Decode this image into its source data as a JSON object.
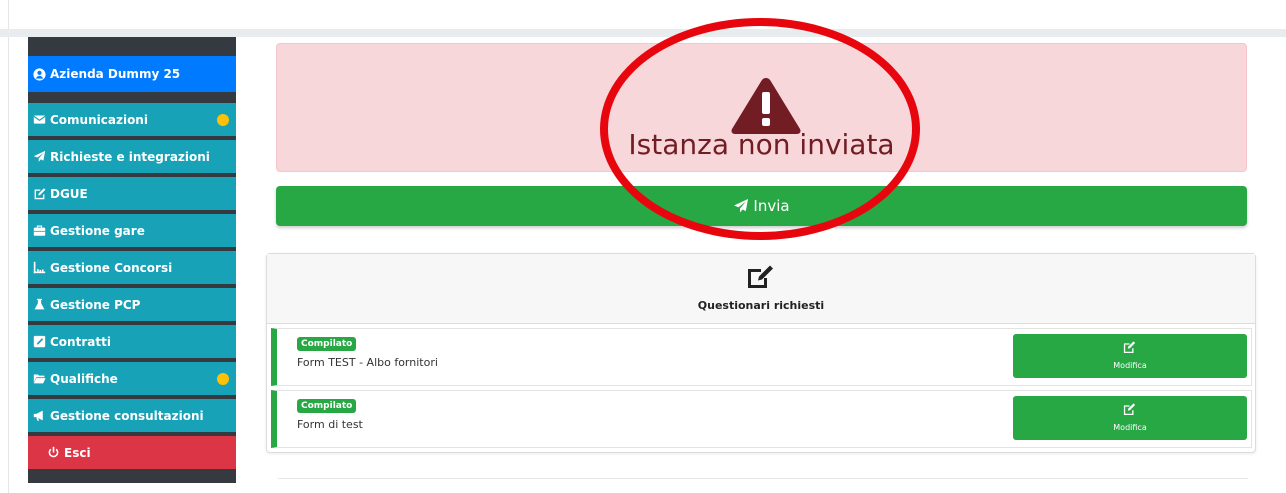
{
  "sidebar": {
    "user": "Azienda Dummy 25",
    "items": [
      {
        "label": "Comunicazioni",
        "icon": "envelope-icon",
        "badge": true
      },
      {
        "label": "Richieste e integrazioni",
        "icon": "paper-plane-icon",
        "badge": false
      },
      {
        "label": "DGUE",
        "icon": "edit-icon",
        "badge": false
      },
      {
        "label": "Gestione gare",
        "icon": "briefcase-icon",
        "badge": false
      },
      {
        "label": "Gestione Concorsi",
        "icon": "chart-icon",
        "badge": false
      },
      {
        "label": "Gestione PCP",
        "icon": "flask-icon",
        "badge": false
      },
      {
        "label": "Contratti",
        "icon": "pencil-square-icon",
        "badge": false
      },
      {
        "label": "Qualifiche",
        "icon": "folder-open-icon",
        "badge": true
      },
      {
        "label": "Gestione consultazioni",
        "icon": "bullhorn-icon",
        "badge": false
      }
    ],
    "exit_label": "Esci",
    "badge_color": "#ffc107"
  },
  "alert": {
    "text": "Istanza non inviata",
    "icon": "warning-triangle-icon"
  },
  "send_button": {
    "label": "Invia",
    "icon": "paper-plane-icon"
  },
  "questionnaires": {
    "header_icon": "edit-icon",
    "title": "Questionari richiesti",
    "forms": [
      {
        "status": "Compilato",
        "name": "Form TEST - Albo fornitori",
        "action": "Modifica"
      },
      {
        "status": "Compilato",
        "name": "Form di test",
        "action": "Modifica"
      }
    ]
  },
  "colors": {
    "accent_green": "#28a745",
    "sidebar_teal": "#17a2b8",
    "user_blue": "#007bff",
    "exit_red": "#dc3545",
    "alert_bg": "#f8d7da",
    "annotation_red": "#e8060e"
  }
}
